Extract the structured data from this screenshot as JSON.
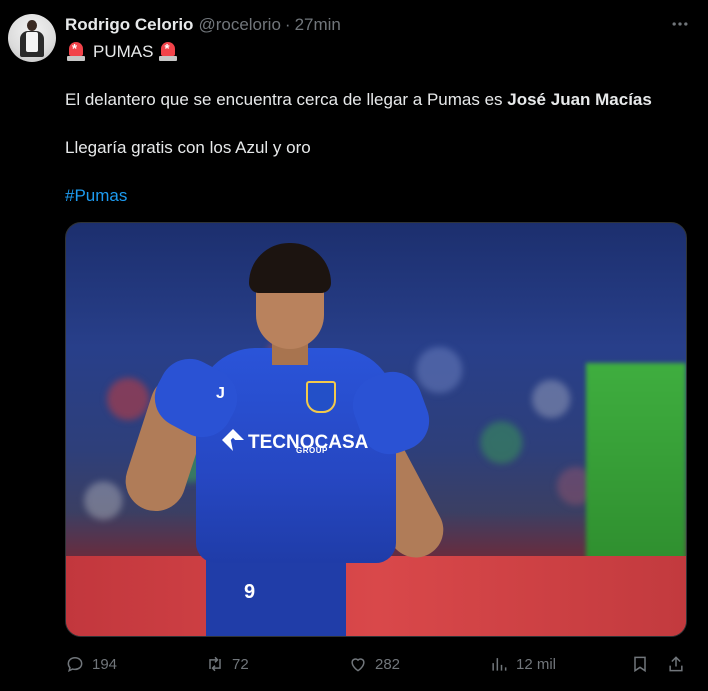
{
  "author": {
    "name": "Rodrigo Celorio",
    "handle": "@rocelorio",
    "separator": "·",
    "time": "27min"
  },
  "tweet": {
    "heading": "PUMAS",
    "line1_prefix": "El delantero que se encuentra cerca de llegar a Pumas es ",
    "line1_bold": "José Juan Macías",
    "line2": "Llegaría gratis con los Azul y oro",
    "hashtag": "#Pumas"
  },
  "media": {
    "sponsor": "TECNOCASA",
    "sponsor_sub": "GROUP",
    "kit_brand": "J",
    "shorts_number": "9"
  },
  "actions": {
    "replies": "194",
    "retweets": "72",
    "likes": "282",
    "views": "12 mil"
  },
  "colors": {
    "background": "#000000",
    "text": "#e7e9ea",
    "muted": "#71767b",
    "link": "#1d9bf0"
  },
  "icons": {
    "reply": "reply-icon",
    "retweet": "retweet-icon",
    "like": "heart-icon",
    "views": "views-icon",
    "bookmark": "bookmark-icon",
    "share": "share-icon",
    "siren": "siren-emoji",
    "more": "more-icon"
  }
}
